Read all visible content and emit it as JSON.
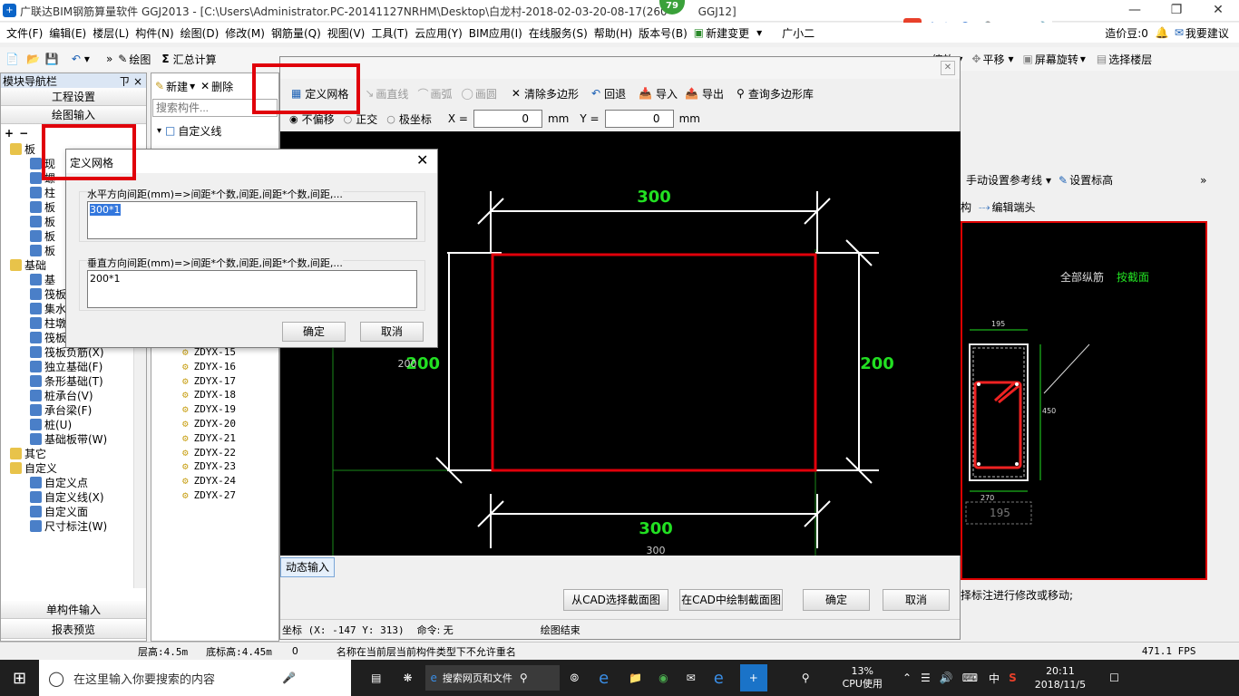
{
  "window": {
    "title": "广联达BIM钢筋算量软件 GGJ2013 - [C:\\Users\\Administrator.PC-20141127NRHM\\Desktop\\白龙村-2018-02-03-20-08-17(260",
    "title_tail": "GGJ12]",
    "badge": "79"
  },
  "ime": {
    "label": "中"
  },
  "menubar": {
    "items": [
      "文件(F)",
      "编辑(E)",
      "楼层(L)",
      "构件(N)",
      "绘图(D)",
      "修改(M)",
      "钢筋量(Q)",
      "视图(V)",
      "工具(T)",
      "云应用(Y)",
      "BIM应用(I)",
      "在线服务(S)",
      "帮助(H)",
      "版本号(B)",
      "新建变更",
      "广小二"
    ],
    "right_price": "造价豆:0",
    "right_suggest": "我要建议"
  },
  "toolbar": {
    "draw": "绘图",
    "sum": "汇总计算",
    "zoom": "缩放",
    "pan": "平移",
    "rotate": "屏幕旋转",
    "select_floor": "选择楼层"
  },
  "nav": {
    "header": "模块导航栏",
    "pin": "ㄗ ×",
    "btn_project": "工程设置",
    "btn_draw": "绘图输入",
    "tree": [
      {
        "label": "板",
        "indent": 1
      },
      {
        "label": "现",
        "indent": 2
      },
      {
        "label": "螺",
        "indent": 2
      },
      {
        "label": "柱",
        "indent": 2
      },
      {
        "label": "板",
        "indent": 2
      },
      {
        "label": "板",
        "indent": 2
      },
      {
        "label": "板",
        "indent": 2
      },
      {
        "label": "板",
        "indent": 2
      },
      {
        "label": "基础",
        "indent": 1
      },
      {
        "label": "基",
        "indent": 2
      },
      {
        "label": "筏板基础(M)",
        "indent": 2
      },
      {
        "label": "集水坑(K)",
        "indent": 2
      },
      {
        "label": "柱墩(Y)",
        "indent": 2
      },
      {
        "label": "筏板主筋(R)",
        "indent": 2
      },
      {
        "label": "筏板负筋(X)",
        "indent": 2
      },
      {
        "label": "独立基础(F)",
        "indent": 2
      },
      {
        "label": "条形基础(T)",
        "indent": 2
      },
      {
        "label": "桩承台(V)",
        "indent": 2
      },
      {
        "label": "承台梁(F)",
        "indent": 2
      },
      {
        "label": "桩(U)",
        "indent": 2
      },
      {
        "label": "基础板带(W)",
        "indent": 2
      },
      {
        "label": "其它",
        "indent": 1
      },
      {
        "label": "自定义",
        "indent": 1
      },
      {
        "label": "自定义点",
        "indent": 2
      },
      {
        "label": "自定义线(X)",
        "indent": 2
      },
      {
        "label": "自定义面",
        "indent": 2
      },
      {
        "label": "尺寸标注(W)",
        "indent": 2
      }
    ],
    "btn_single": "单构件输入",
    "btn_report": "报表预览"
  },
  "complist": {
    "new": "新建",
    "delete": "删除",
    "search_placeholder": "搜索构件...",
    "root": "自定义线",
    "items": [
      "ZDYX-15",
      "ZDYX-16",
      "ZDYX-17",
      "ZDYX-18",
      "ZDYX-19",
      "ZDYX-20",
      "ZDYX-21",
      "ZDYX-22",
      "ZDYX-23",
      "ZDYX-24",
      "ZDYX-27"
    ]
  },
  "dialog": {
    "tools": {
      "define_grid": "定义网格",
      "line": "画直线",
      "arc": "画弧",
      "circle": "画圆",
      "clear": "清除多边形",
      "undo": "回退",
      "import": "导入",
      "export": "导出",
      "query": "查询多边形库"
    },
    "options": {
      "no_offset": "不偏移",
      "ortho": "正交",
      "polar": "极坐标",
      "x_label": "X =",
      "x_value": "0",
      "y_label": "Y =",
      "y_value": "0",
      "unit": "mm"
    },
    "canvas": {
      "dim_top": "300",
      "dim_bottom": "300",
      "dim_bottom_small": "300",
      "dim_left": "200",
      "dim_left_small": "200",
      "dim_right": "200"
    },
    "dynamic_input": "动态输入",
    "buttons": {
      "from_cad": "从CAD选择截面图",
      "draw_cad": "在CAD中绘制截面图",
      "ok": "确定",
      "cancel": "取消"
    },
    "status": {
      "coord": "坐标 (X: -147 Y: 313)",
      "command": "命令: 无",
      "end": "绘图结束"
    }
  },
  "grid_dialog": {
    "title": "定义网格",
    "h_label": "水平方向间距(mm)=>间距*个数,间距,间距*个数,间距,...",
    "h_value": "300*1",
    "v_label": "垂直方向间距(mm)=>间距*个数,间距,间距*个数,间距,...",
    "v_value": "200*1",
    "ok": "确定",
    "cancel": "取消"
  },
  "rightpanel": {
    "manual_ref": "手动设置参考线",
    "set_elev": "设置标高",
    "struct": "构",
    "edit_hook": "编辑端头",
    "all_long": "全部纵筋",
    "by_section": "按截面",
    "dims": [
      "195",
      "450",
      "270",
      "195"
    ],
    "note": "择标注进行修改或移动;"
  },
  "statusbar": {
    "floor_h": "层高:4.5m",
    "base_h": "底标高:4.45m",
    "zero": "0",
    "message": "名称在当前层当前构件类型下不允许重名",
    "fps": "471.1 FPS"
  },
  "taskbar": {
    "search": "在这里输入你要搜索的内容",
    "web_search": "搜索网页和文件",
    "cpu_pct": "13%",
    "cpu_label": "CPU使用",
    "ime": "中",
    "time": "20:11",
    "date": "2018/11/5"
  },
  "colors": {
    "highlight_red": "#e0000a",
    "dim_green": "#22e022",
    "canvas_bg": "#000000"
  }
}
